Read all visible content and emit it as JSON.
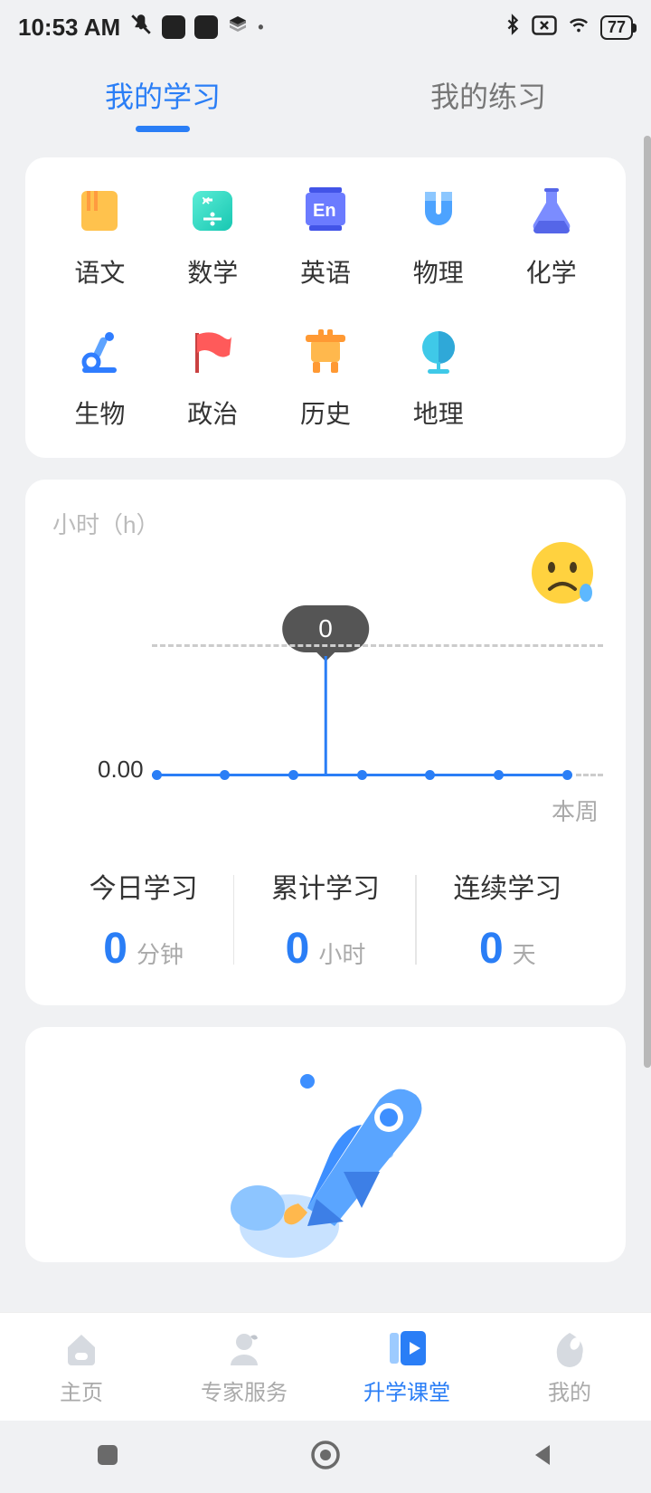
{
  "status": {
    "time": "10:53 AM",
    "battery": "77"
  },
  "tabs": {
    "study": "我的学习",
    "practice": "我的练习"
  },
  "subjects": [
    {
      "label": "语文"
    },
    {
      "label": "数学"
    },
    {
      "label": "英语"
    },
    {
      "label": "物理"
    },
    {
      "label": "化学"
    },
    {
      "label": "生物"
    },
    {
      "label": "政治"
    },
    {
      "label": "历史"
    },
    {
      "label": "地理"
    }
  ],
  "chart_data": {
    "type": "line",
    "title": "",
    "ylabel": "小时（h）",
    "xlabel": "本周",
    "ylim": [
      0,
      0
    ],
    "y_tick": "0.00",
    "tooltip_value": "0",
    "categories": [
      "",
      "",
      "",
      "",
      "",
      "",
      ""
    ],
    "values": [
      0,
      0,
      0,
      0,
      0,
      0,
      0
    ]
  },
  "stats": {
    "today": {
      "title": "今日学习",
      "value": "0",
      "unit": "分钟"
    },
    "total": {
      "title": "累计学习",
      "value": "0",
      "unit": "小时"
    },
    "streak": {
      "title": "连续学习",
      "value": "0",
      "unit": "天"
    }
  },
  "nav": {
    "home": "主页",
    "expert": "专家服务",
    "course": "升学课堂",
    "mine": "我的"
  }
}
